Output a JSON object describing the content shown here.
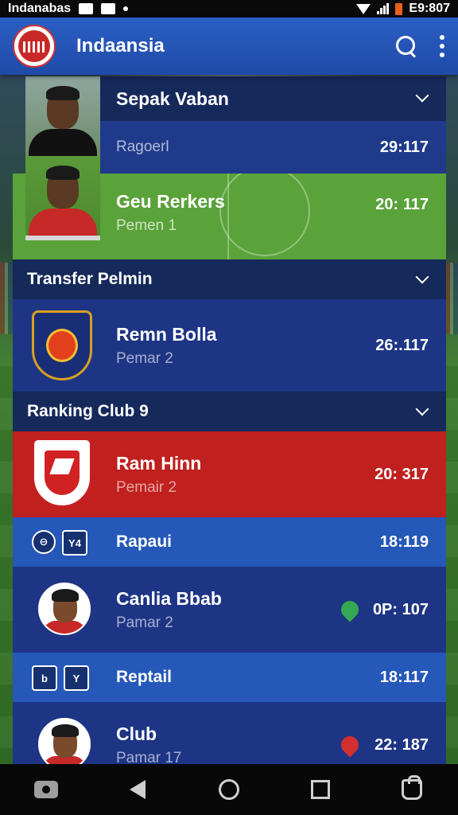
{
  "status_bar": {
    "app_name": "Indanabas",
    "clock": "E9:807"
  },
  "app_bar": {
    "title": "Indaansia"
  },
  "card1": {
    "header_title": "Sepak Vaban",
    "row1_label": "Ragoerl",
    "row1_time": "29:117",
    "row2_title": "Geu Rerkers",
    "row2_sub": "Pemen 1",
    "row2_time": "20: 117"
  },
  "sections": [
    {
      "header": "Transfer Pelmin",
      "title": "Remn Bolla",
      "sub": "Pemar 2",
      "time": "26:.117"
    },
    {
      "header": "Ranking Club 9",
      "title": "Ram Hinn",
      "sub": "Pemair 2",
      "time": "20: 317"
    }
  ],
  "list": [
    {
      "header_title": "Rapaui",
      "header_time": "18:119",
      "icon_a": "⊖",
      "icon_b": "Y4",
      "title": "Canlia Bbab",
      "sub": "Pamar 2",
      "time": "0P: 107",
      "heart": "green"
    },
    {
      "header_title": "Reptail",
      "header_time": "18:117",
      "icon_a": "b",
      "icon_b": "Y",
      "title": "Club",
      "sub": "Pamar 17",
      "time": "22: 187",
      "heart": "red"
    }
  ],
  "colors": {
    "app_bar": "#2b5fc4",
    "section_header": "#15295a",
    "row_dark": "#1e3585",
    "green": "#5aa23a",
    "red": "#c0201e"
  }
}
